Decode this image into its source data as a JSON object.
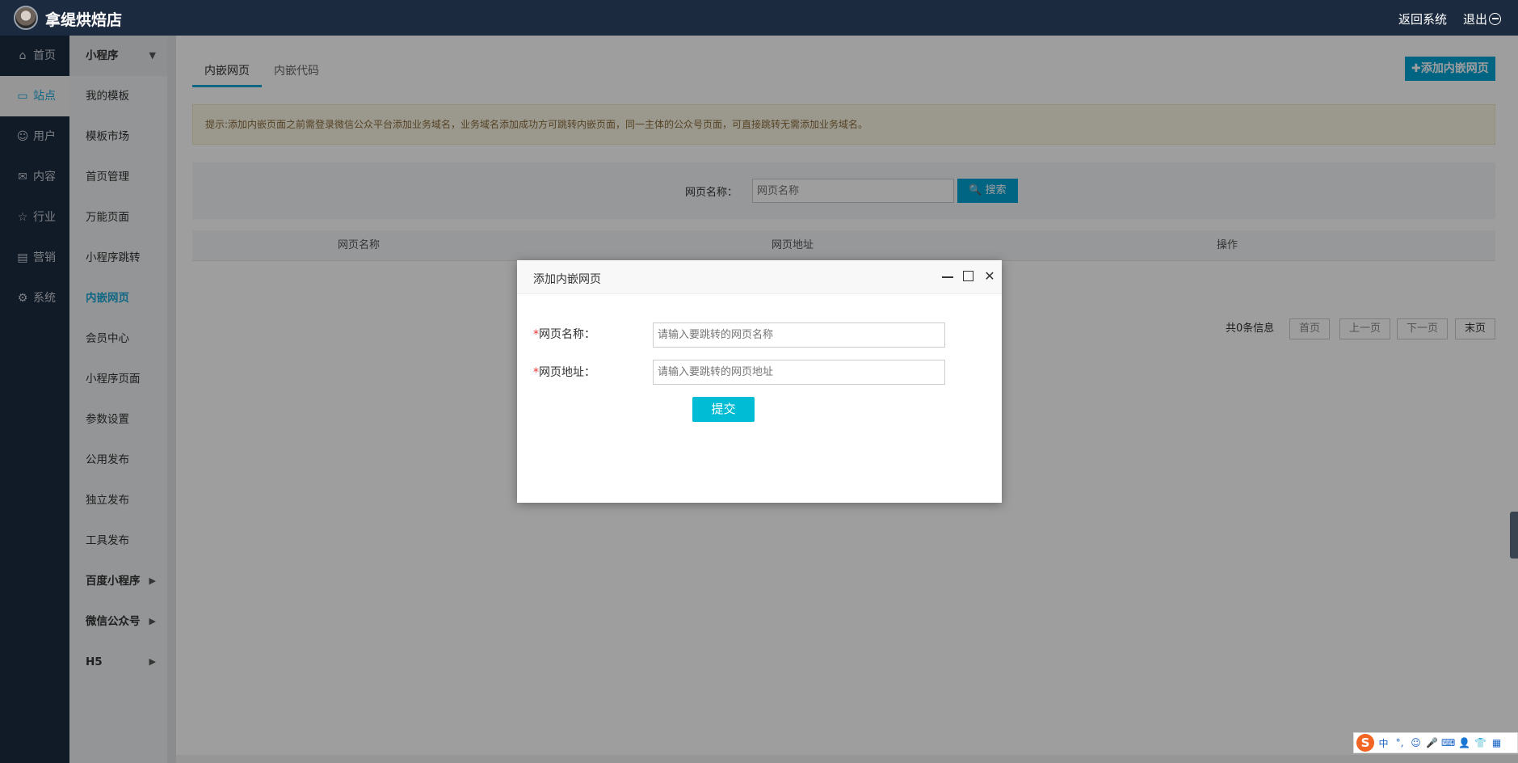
{
  "header": {
    "shop_name": "拿缇烘焙店",
    "back_label": "返回系统",
    "logout_label": "退出"
  },
  "nav1": [
    {
      "label": "首页",
      "icon": "home-icon",
      "glyph": "⌂"
    },
    {
      "label": "站点",
      "icon": "monitor-icon",
      "glyph": "▭"
    },
    {
      "label": "用户",
      "icon": "user-icon",
      "glyph": "☺"
    },
    {
      "label": "内容",
      "icon": "inbox-icon",
      "glyph": "✉"
    },
    {
      "label": "行业",
      "icon": "star-icon",
      "glyph": "☆"
    },
    {
      "label": "营销",
      "icon": "wallet-icon",
      "glyph": "▤"
    },
    {
      "label": "系统",
      "icon": "gear-icon",
      "glyph": "⚙"
    }
  ],
  "nav2": [
    {
      "label": "小程序"
    },
    {
      "label": "我的模板"
    },
    {
      "label": "模板市场"
    },
    {
      "label": "首页管理"
    },
    {
      "label": "万能页面"
    },
    {
      "label": "小程序跳转"
    },
    {
      "label": "内嵌网页"
    },
    {
      "label": "会员中心"
    },
    {
      "label": "小程序页面"
    },
    {
      "label": "参数设置"
    },
    {
      "label": "公用发布"
    },
    {
      "label": "独立发布"
    },
    {
      "label": "工具发布"
    },
    {
      "label": "百度小程序"
    },
    {
      "label": "微信公众号"
    },
    {
      "label": "H5"
    }
  ],
  "main": {
    "tabs": [
      "内嵌网页",
      "内嵌代码"
    ],
    "add_button": "✚添加内嵌网页",
    "tip": "提示:添加内嵌页面之前需登录微信公众平台添加业务域名，业务域名添加成功方可跳转内嵌页面，同一主体的公众号页面，可直接跳转无需添加业务域名。",
    "search_label": "网页名称：",
    "search_placeholder": "网页名称",
    "search_button": "搜索",
    "columns": [
      "网页名称",
      "网页地址",
      "操作"
    ],
    "pager": {
      "total": "共0条信息",
      "first": "首页",
      "prev": "上一页",
      "next": "下一页",
      "last": "末页"
    }
  },
  "dialog": {
    "title": "添加内嵌网页",
    "required_mark": "*",
    "name_label": "网页名称：",
    "name_placeholder": "请输入要跳转的网页名称",
    "url_label": "网页地址：",
    "url_placeholder": "请输入要跳转的网页地址",
    "submit": "提交"
  },
  "ime": {
    "logo": "S",
    "items": [
      "中",
      "°,",
      "☺",
      "🎤",
      "⌨",
      "👤",
      "👕",
      "▦"
    ]
  }
}
